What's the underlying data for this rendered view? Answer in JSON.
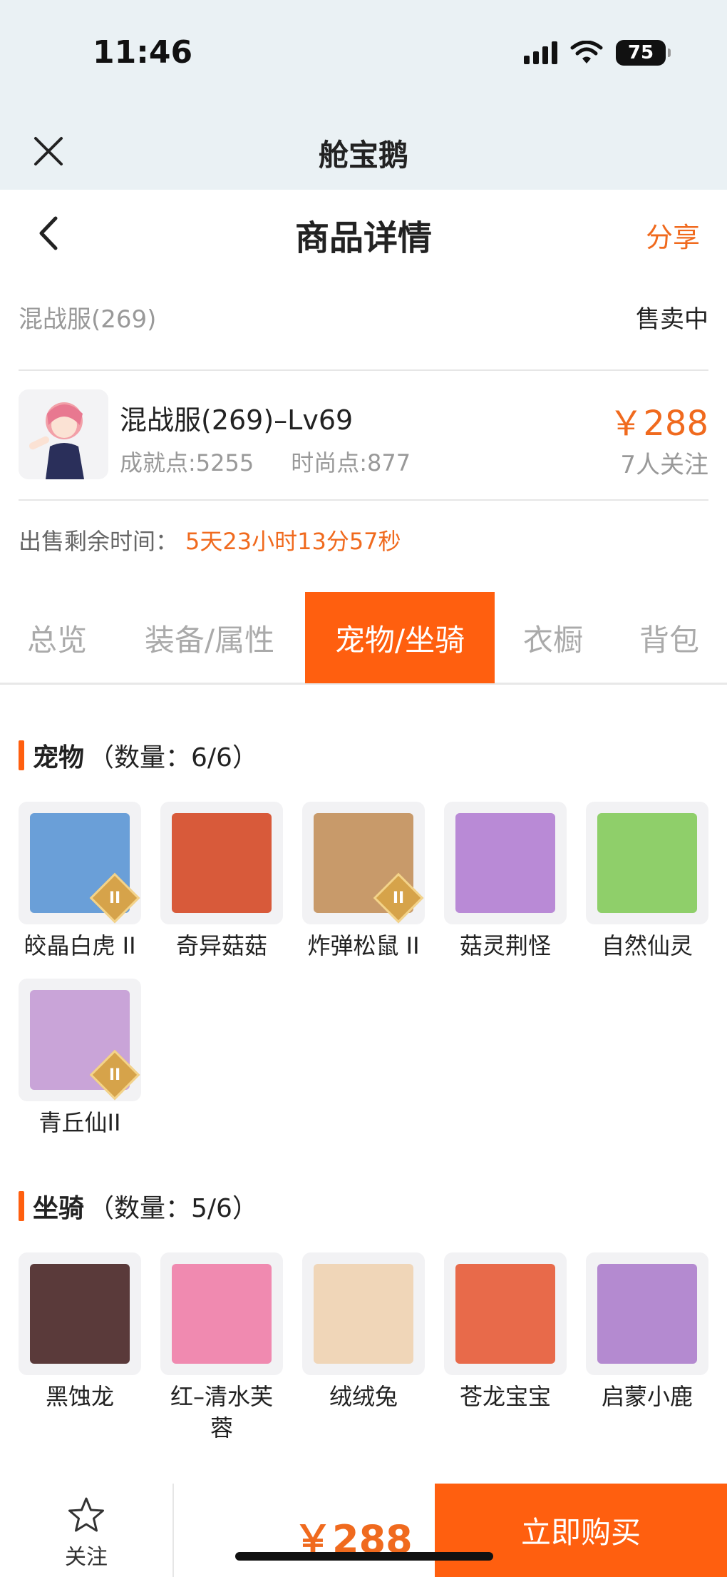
{
  "status_bar": {
    "time": "11:46",
    "battery": "75"
  },
  "app": {
    "title": "舱宝鹅"
  },
  "header": {
    "title": "商品详情",
    "share_label": "分享"
  },
  "listing": {
    "server": "混战服(269)",
    "status": "售卖中",
    "name": "混战服(269)–Lv69",
    "achievement": "成就点:5255",
    "fashion": "时尚点:877",
    "price": "￥288",
    "followers": "7人关注",
    "remaining_label": "出售剩余时间：",
    "remaining_value": "5天23小时13分57秒"
  },
  "tabs": [
    {
      "label": "总览"
    },
    {
      "label": "装备/属性"
    },
    {
      "label": "宠物/坐骑"
    },
    {
      "label": "衣橱"
    },
    {
      "label": "背包"
    }
  ],
  "pets": {
    "title": "宠物",
    "count": "（数量：6/6）",
    "items": [
      {
        "name": "皎晶白虎 II",
        "color": "#6a9fd8"
      },
      {
        "name": "奇异菇菇",
        "color": "#d85a3a"
      },
      {
        "name": "炸弹松鼠 II",
        "color": "#c89a6a"
      },
      {
        "name": "菇灵荆怪",
        "color": "#b98ad6"
      },
      {
        "name": "自然仙灵",
        "color": "#8fcf6a"
      },
      {
        "name": "青丘仙II",
        "color": "#c9a4d8"
      }
    ]
  },
  "mounts": {
    "title": "坐骑",
    "count": "（数量：5/6）",
    "items": [
      {
        "name": "黑蚀龙",
        "color": "#5a3a3a"
      },
      {
        "name": "红–清水芙蓉",
        "color": "#f08ab0"
      },
      {
        "name": "绒绒兔",
        "color": "#f0d6b8"
      },
      {
        "name": "苍龙宝宝",
        "color": "#e86a4a"
      },
      {
        "name": "启蒙小鹿",
        "color": "#b48ad0"
      }
    ]
  },
  "bottom_bar": {
    "follow_label": "关注",
    "price": "￥288",
    "buy_label": "立即购买"
  },
  "colors": {
    "accent": "#ff5f0f",
    "price": "#f06a1e"
  }
}
